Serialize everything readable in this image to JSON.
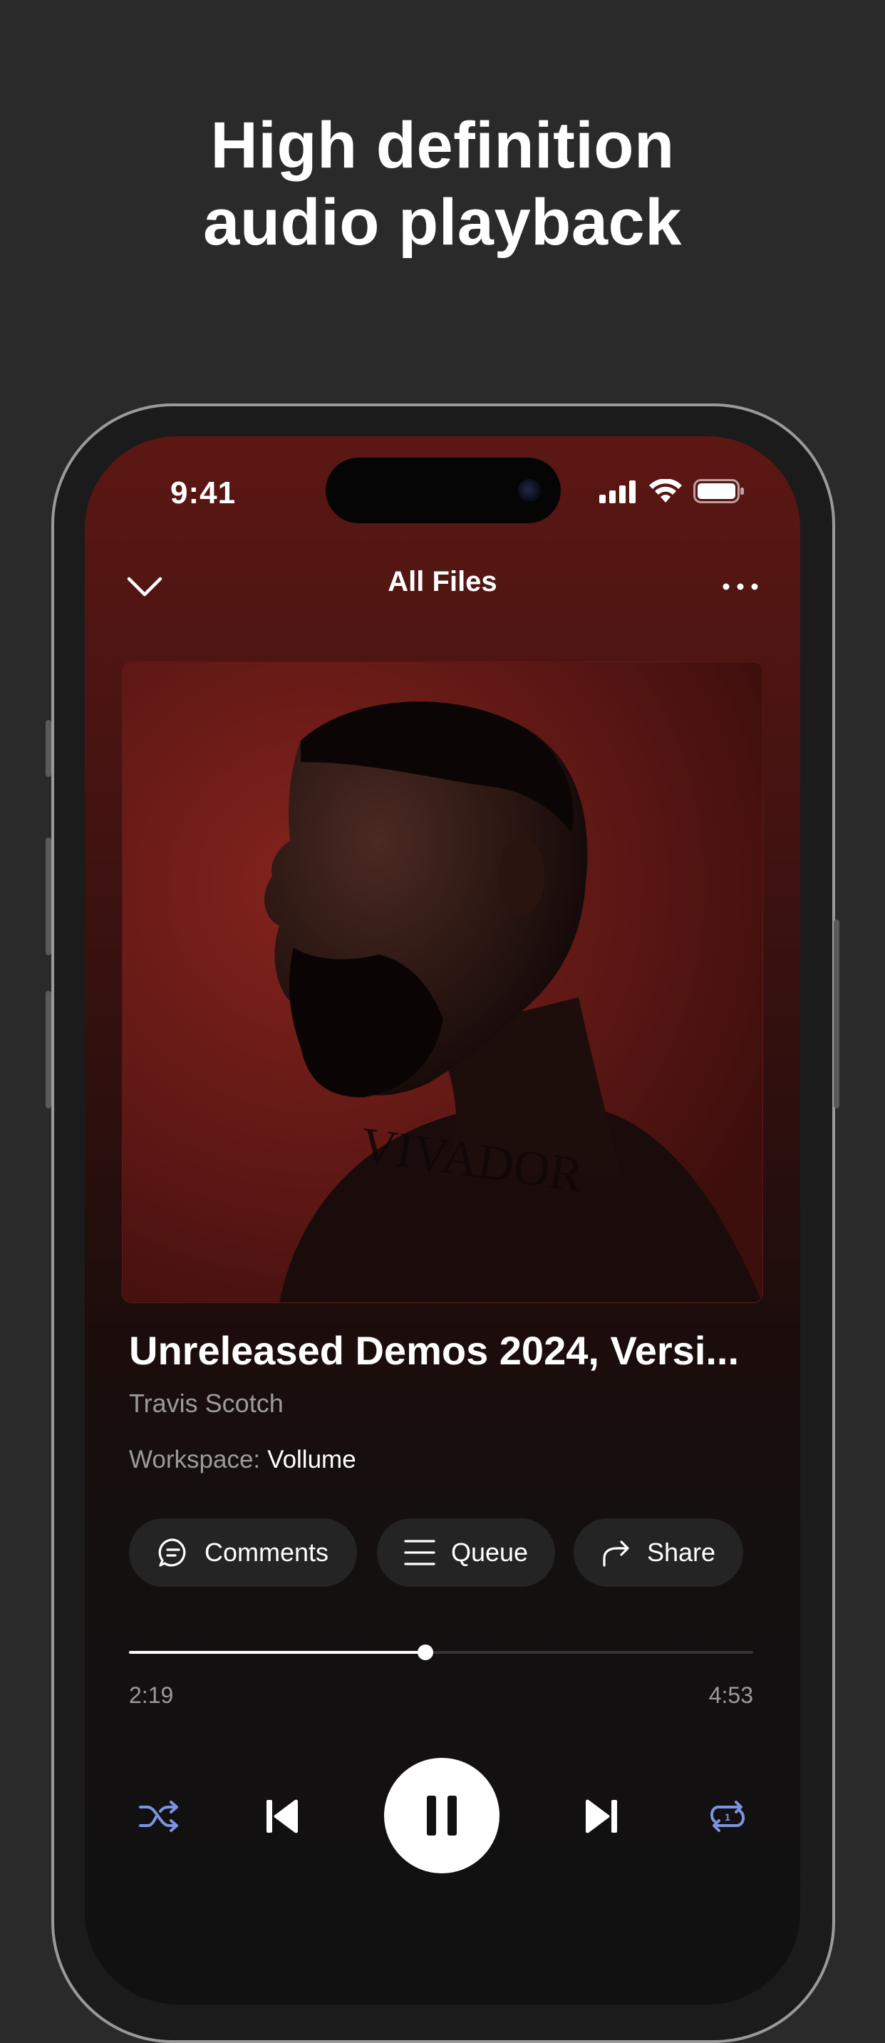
{
  "promo": {
    "headline_line1": "High definition",
    "headline_line2": "audio playback"
  },
  "status_bar": {
    "time": "9:41",
    "icons": [
      "signal-icon",
      "wifi-icon",
      "battery-icon"
    ]
  },
  "nav": {
    "title": "All Files",
    "back_icon": "chevron-down-icon",
    "more_icon": "more-horizontal-icon"
  },
  "track": {
    "title": "Unreleased Demos 2024, Versi...",
    "artist": "Travis Scotch",
    "workspace_label": "Workspace:",
    "workspace_name": "Vollume"
  },
  "actions": [
    {
      "label": "Comments",
      "icon": "comment-icon"
    },
    {
      "label": "Queue",
      "icon": "queue-icon"
    },
    {
      "label": "Share",
      "icon": "share-icon"
    }
  ],
  "playback": {
    "elapsed": "2:19",
    "duration": "4:53",
    "progress": 0.475,
    "state": "playing"
  },
  "controls": [
    "shuffle-icon",
    "previous-icon",
    "pause-icon",
    "next-icon",
    "repeat-one-icon"
  ],
  "colors": {
    "accent": "#7d93e0",
    "background": "#2a2a2a",
    "art_red": "#6a1a16"
  }
}
